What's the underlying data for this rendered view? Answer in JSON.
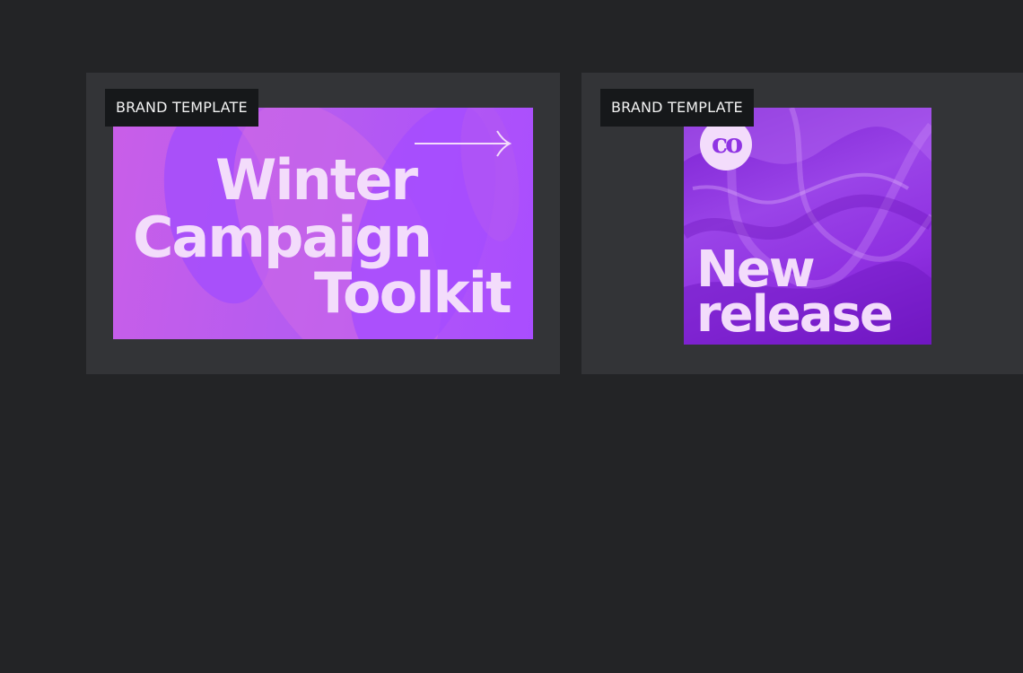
{
  "cards": [
    {
      "badge": "BRAND TEMPLATE",
      "lines": [
        "Winter",
        "Campaign",
        "Toolkit"
      ],
      "colors": {
        "background": "#b65cf0",
        "text": "#f3dcfb",
        "shapes": "#a24bff"
      },
      "icon": "arrow-right-icon"
    },
    {
      "badge": "BRAND TEMPLATE",
      "lines": [
        "New",
        "release"
      ],
      "logo_text": "co",
      "colors": {
        "background": "#8e2fe0",
        "text": "#f3dcfb"
      },
      "icon": "co-logo-icon"
    }
  ]
}
